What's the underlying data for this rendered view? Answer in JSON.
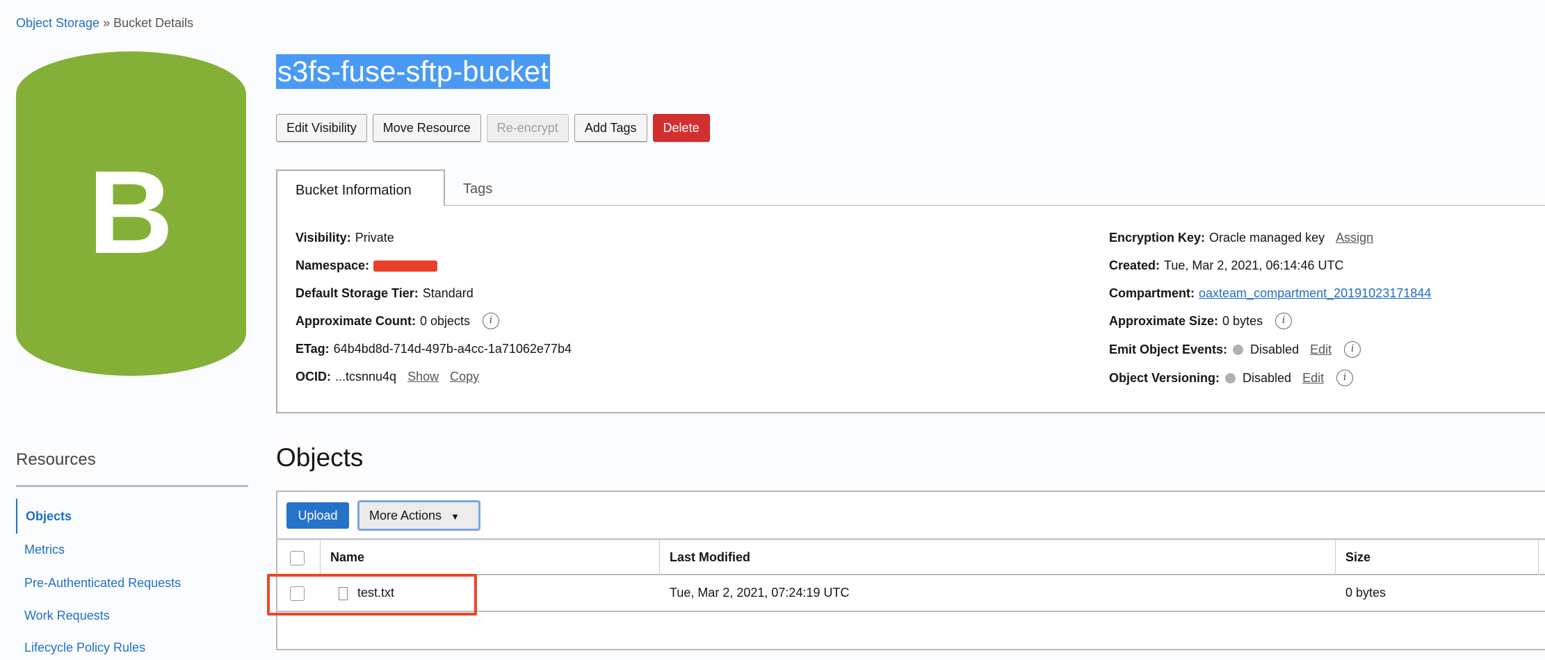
{
  "breadcrumb": {
    "root": "Object Storage",
    "sep": " » ",
    "current": "Bucket Details"
  },
  "avatar": {
    "letter": "B",
    "color": "#84b037"
  },
  "title": "s3fs-fuse-sftp-bucket",
  "actions": [
    "Edit Visibility",
    "Move Resource",
    "Re-encrypt",
    "Add Tags",
    "Delete"
  ],
  "tabs": [
    "Bucket Information",
    "Tags"
  ],
  "info_left": {
    "visibility": {
      "label": "Visibility:",
      "value": "Private"
    },
    "namespace": {
      "label": "Namespace:"
    },
    "tier": {
      "label": "Default Storage Tier:",
      "value": "Standard"
    },
    "count": {
      "label": "Approximate Count:",
      "value": "0 objects"
    },
    "etag": {
      "label": "ETag:",
      "value": "64b4bd8d-714d-497b-a4cc-1a71062e77b4"
    },
    "ocid": {
      "label": "OCID:",
      "value": "...tcsnnu4q",
      "show": "Show",
      "copy": "Copy"
    }
  },
  "info_right": {
    "enc": {
      "label": "Encryption Key:",
      "value": "Oracle managed key",
      "action": "Assign"
    },
    "created": {
      "label": "Created:",
      "value": "Tue, Mar 2, 2021, 06:14:46 UTC"
    },
    "compartment": {
      "label": "Compartment:",
      "value": "oaxteam_compartment_20191023171844"
    },
    "size": {
      "label": "Approximate Size:",
      "value": "0 bytes"
    },
    "events": {
      "label": "Emit Object Events:",
      "value": "Disabled",
      "action": "Edit"
    },
    "versioning": {
      "label": "Object Versioning:",
      "value": "Disabled",
      "action": "Edit"
    }
  },
  "resources": {
    "heading": "Resources",
    "items": [
      "Objects",
      "Metrics",
      "Pre-Authenticated Requests",
      "Work Requests",
      "Lifecycle Policy Rules"
    ]
  },
  "objects": {
    "heading": "Objects",
    "upload": "Upload",
    "more": "More Actions",
    "columns": [
      "Name",
      "Last Modified",
      "Size"
    ],
    "rows": [
      {
        "name": "test.txt",
        "modified": "Tue, Mar 2, 2021, 07:24:19 UTC",
        "size": "0 bytes"
      }
    ]
  }
}
